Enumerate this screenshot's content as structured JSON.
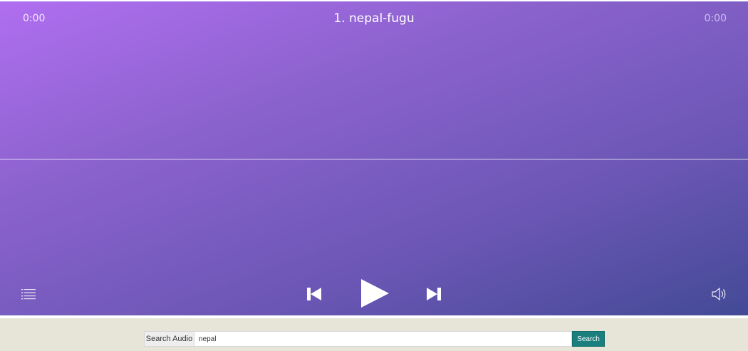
{
  "player": {
    "current_time": "0:00",
    "duration": "0:00",
    "track_title": "1. nepal-fugu",
    "progress": 0,
    "controls": {
      "playlist_icon": "list-icon",
      "prev_icon": "skip-previous-icon",
      "play_icon": "play-icon",
      "next_icon": "skip-next-icon",
      "volume_icon": "volume-icon"
    },
    "colors": {
      "gradient_start": "#b06ef0",
      "gradient_end": "#434a96"
    }
  },
  "search": {
    "label": "Search Audio",
    "value": "nepal",
    "button_label": "Search",
    "colors": {
      "bar_background": "#e6e5d8",
      "button": "#1b7f7e"
    }
  }
}
